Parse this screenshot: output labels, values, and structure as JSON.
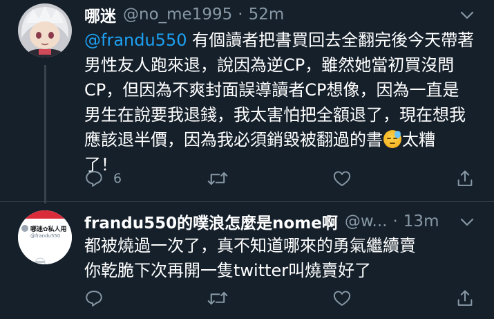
{
  "tweets": [
    {
      "display_name": "哪迷",
      "handle": "@no_me1995",
      "separator": "·",
      "time": "52m",
      "mention": "@frandu550",
      "lines": [
        " 有個讀者把書買回去全翻完後今天帶著",
        "男性友人跑來退，說因為逆CP，雖然她當初買沒問",
        "CP，但因為不爽封面誤導讀者CP想像，因為一直是",
        "男生在說要我退錢，我太害怕把全額退了，現在想我",
        "應該退半價，因為我必須銷毀被翻過的書",
        "太糟",
        "了！"
      ],
      "emoji_icon": "downcast-face-with-sweat-icon",
      "reply_count": "6"
    },
    {
      "display_name": "frandu550的噗浪怎麼是nome啊",
      "handle": "@w...",
      "separator": "·",
      "time": "13m",
      "avatar_title": "哪迷✿私人用",
      "avatar_handle": "@frandu550",
      "lines": [
        "都被燒過一次了，真不知道哪來的勇氣繼續賣",
        "你乾脆下次再開一隻twitter叫燒賣好了"
      ]
    }
  ],
  "icons": {
    "reply": "reply-icon",
    "retweet": "retweet-icon",
    "like": "heart-icon",
    "share": "share-icon",
    "more": "chevron-down-icon"
  },
  "colors": {
    "background": "#15202b",
    "text": "#ffffff",
    "secondary": "#8899a6",
    "link": "#1da1f2",
    "divider": "#38444d"
  }
}
